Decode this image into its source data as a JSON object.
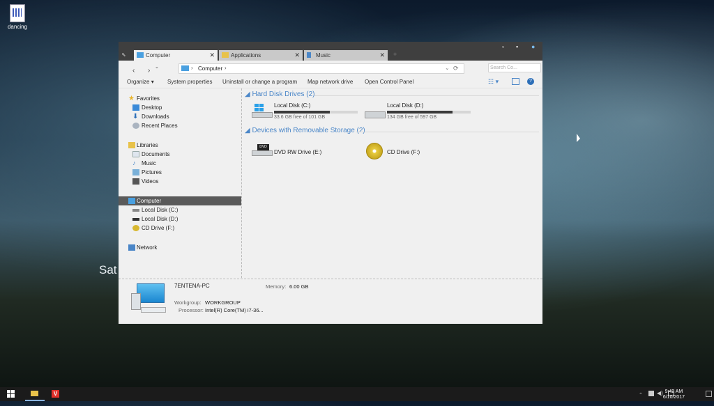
{
  "desktop": {
    "icon_label": "dancing",
    "overlay_text": "Sat"
  },
  "window": {
    "tabs": [
      {
        "label": "Computer",
        "active": true
      },
      {
        "label": "Applications",
        "active": false
      },
      {
        "label": "Music",
        "active": false
      }
    ],
    "address": {
      "path": "Computer",
      "separator": "›"
    },
    "search_placeholder": "Search Co...",
    "toolbar": {
      "organize": "Organize",
      "system_properties": "System properties",
      "uninstall": "Uninstall or change a program",
      "map_network": "Map network drive",
      "control_panel": "Open Control Panel"
    },
    "nav": {
      "favorites": "Favorites",
      "desktop": "Desktop",
      "downloads": "Downloads",
      "recent": "Recent Places",
      "libraries": "Libraries",
      "documents": "Documents",
      "music": "Music",
      "pictures": "Pictures",
      "videos": "Videos",
      "computer": "Computer",
      "local_c": "Local Disk (C:)",
      "local_d": "Local Disk (D:)",
      "cd_f": "CD Drive (F:)",
      "network": "Network"
    },
    "groups": {
      "hdd": "Hard Disk Drives (2)",
      "removable": "Devices with Removable Storage (2)"
    },
    "drives": [
      {
        "name": "Local Disk (C:)",
        "free": "33.6 GB free of 101 GB",
        "used_fraction": 0.67
      },
      {
        "name": "Local Disk (D:)",
        "free": "134 GB free of 597 GB",
        "used_fraction": 0.78
      }
    ],
    "removable": [
      {
        "name": "DVD RW Drive (E:)"
      },
      {
        "name": "CD Drive (F:)"
      }
    ],
    "details": {
      "pc_name": "7ENTENA-PC",
      "memory_label": "Memory:",
      "memory_value": "6.00 GB",
      "workgroup_label": "Workgroup:",
      "workgroup_value": "WORKGROUP",
      "processor_label": "Processor:",
      "processor_value": "Intel(R) Core(TM) i7-36..."
    }
  },
  "taskbar": {
    "time": "9:42 AM",
    "date": "6/10/2017"
  },
  "colors": {
    "accent": "#4a86c8",
    "titlebar": "#3f3f3f",
    "taskbar": "#1b1b1b"
  }
}
